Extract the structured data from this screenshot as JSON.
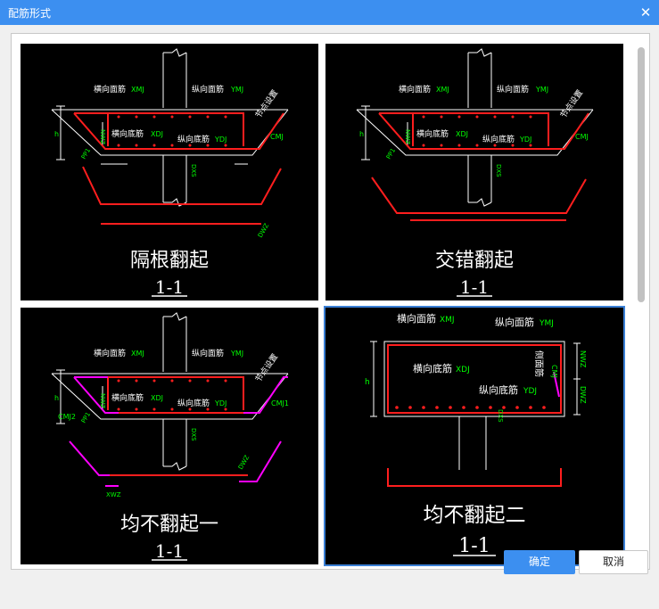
{
  "window": {
    "title": "配筋形式",
    "close_icon": "close-icon"
  },
  "options": [
    {
      "name": "隔根翻起",
      "section": "1-1",
      "selected": false
    },
    {
      "name": "交错翻起",
      "section": "1-1",
      "selected": false
    },
    {
      "name": "均不翻起一",
      "section": "1-1",
      "selected": false
    },
    {
      "name": "均不翻起二",
      "section": "1-1",
      "selected": true
    }
  ],
  "diagram_labels": {
    "top_transverse": "横向面筋",
    "top_transverse_code": "XMJ",
    "top_longitudinal": "纵向面筋",
    "top_longitudinal_code": "YMJ",
    "bottom_transverse": "横向底筋",
    "bottom_transverse_code": "XDJ",
    "bottom_longitudinal": "纵向底筋",
    "bottom_longitudinal_code": "YDJ",
    "node_setting": "节点设置",
    "cmj": "CMJ",
    "cmj1": "CMJ1",
    "cmj2": "CMJ2",
    "nwz": "NWZ",
    "dwz": "DWZ",
    "pp1": "PP1",
    "dwz2": "DWZ2",
    "xwz": "XWZ",
    "h": "h",
    "dxs": "DXS",
    "side_face": "侧面筋",
    "cmj_vertical": "CMJ"
  },
  "colors": {
    "rebar": "#ff1e1e",
    "label": "#ffffff",
    "code": "#00ff00",
    "magenta": "#ff00ff",
    "selection": "#3a7fd5"
  },
  "buttons": {
    "ok": "确定",
    "cancel": "取消"
  }
}
